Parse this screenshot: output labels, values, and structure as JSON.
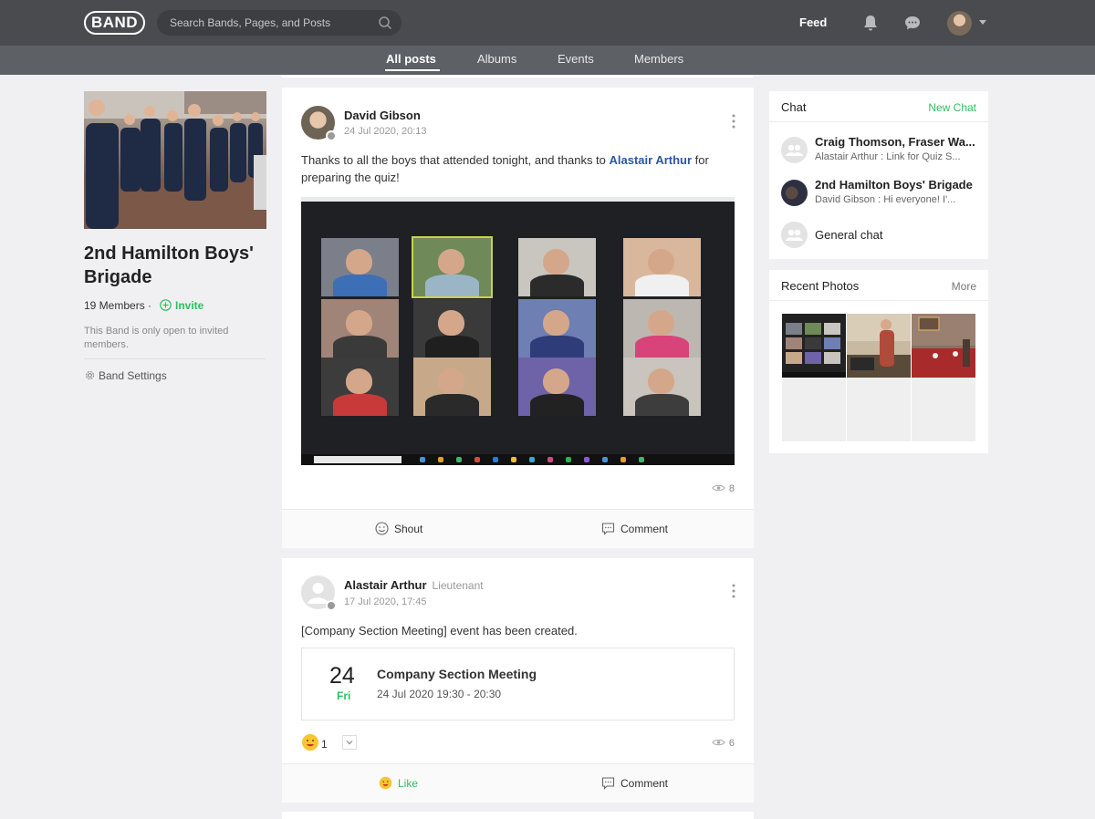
{
  "header": {
    "logo": "BAND",
    "search_placeholder": "Search Bands, Pages, and Posts",
    "feed_label": "Feed"
  },
  "tabs": [
    {
      "label": "All posts",
      "active": true
    },
    {
      "label": "Albums",
      "active": false
    },
    {
      "label": "Events",
      "active": false
    },
    {
      "label": "Members",
      "active": false
    }
  ],
  "band": {
    "name": "2nd Hamilton Boys' Brigade",
    "members": "19 Members",
    "invite": "Invite",
    "description": "This Band is only open to invited members.",
    "settings": "Band Settings"
  },
  "posts": [
    {
      "author": "David Gibson",
      "date": "24 Jul 2020, 20:13",
      "text_before": "Thanks to all the boys that attended tonight, and thanks to ",
      "mention": "Alastair Arthur",
      "text_after": " for preparing the quiz!",
      "views": "8",
      "actions": [
        "Shout",
        "Comment"
      ]
    },
    {
      "author": "Alastair Arthur",
      "role": "Lieutenant",
      "date": "17 Jul 2020, 17:45",
      "text": "[Company Section Meeting] event has been created.",
      "event": {
        "day": "24",
        "weekday": "Fri",
        "title": "Company Section Meeting",
        "time": "24 Jul 2020 19:30 - 20:30"
      },
      "reaction_count": "1",
      "views": "6",
      "actions": [
        "Like",
        "Comment"
      ]
    }
  ],
  "chat": {
    "title": "Chat",
    "new_chat": "New Chat",
    "items": [
      {
        "name": "Craig Thomson, Fraser Wa...",
        "preview": "Alastair Arthur : Link for Quiz S..."
      },
      {
        "name": "2nd Hamilton Boys' Brigade",
        "preview": "David Gibson : Hi everyone! I'..."
      },
      {
        "name": "General chat",
        "preview": ""
      }
    ]
  },
  "recent_photos": {
    "title": "Recent Photos",
    "more": "More"
  },
  "colors": {
    "topbar": "#494b4f",
    "tabbar": "#5d6065",
    "accent_green": "#2fbf5e",
    "mention_blue": "#2b56a4"
  }
}
